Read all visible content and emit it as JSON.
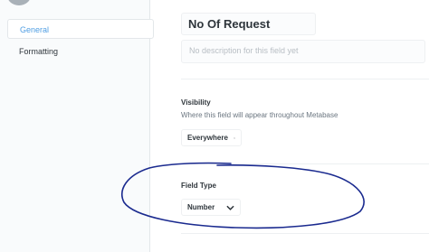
{
  "sidebar": {
    "items": [
      {
        "label": "General",
        "active": true
      },
      {
        "label": "Formatting",
        "active": false
      }
    ]
  },
  "field": {
    "name_value": "No Of Request",
    "description_placeholder": "No description for this field yet"
  },
  "visibility": {
    "title": "Visibility",
    "description": "Where this field will appear throughout Metabase",
    "selected": "Everywhere"
  },
  "field_type": {
    "title": "Field Type",
    "selected": "Number"
  },
  "colors": {
    "accent": "#509ee3",
    "annotation": "#1a2a8f"
  },
  "icons": {
    "select_chevron": "chevron-down-icon"
  }
}
